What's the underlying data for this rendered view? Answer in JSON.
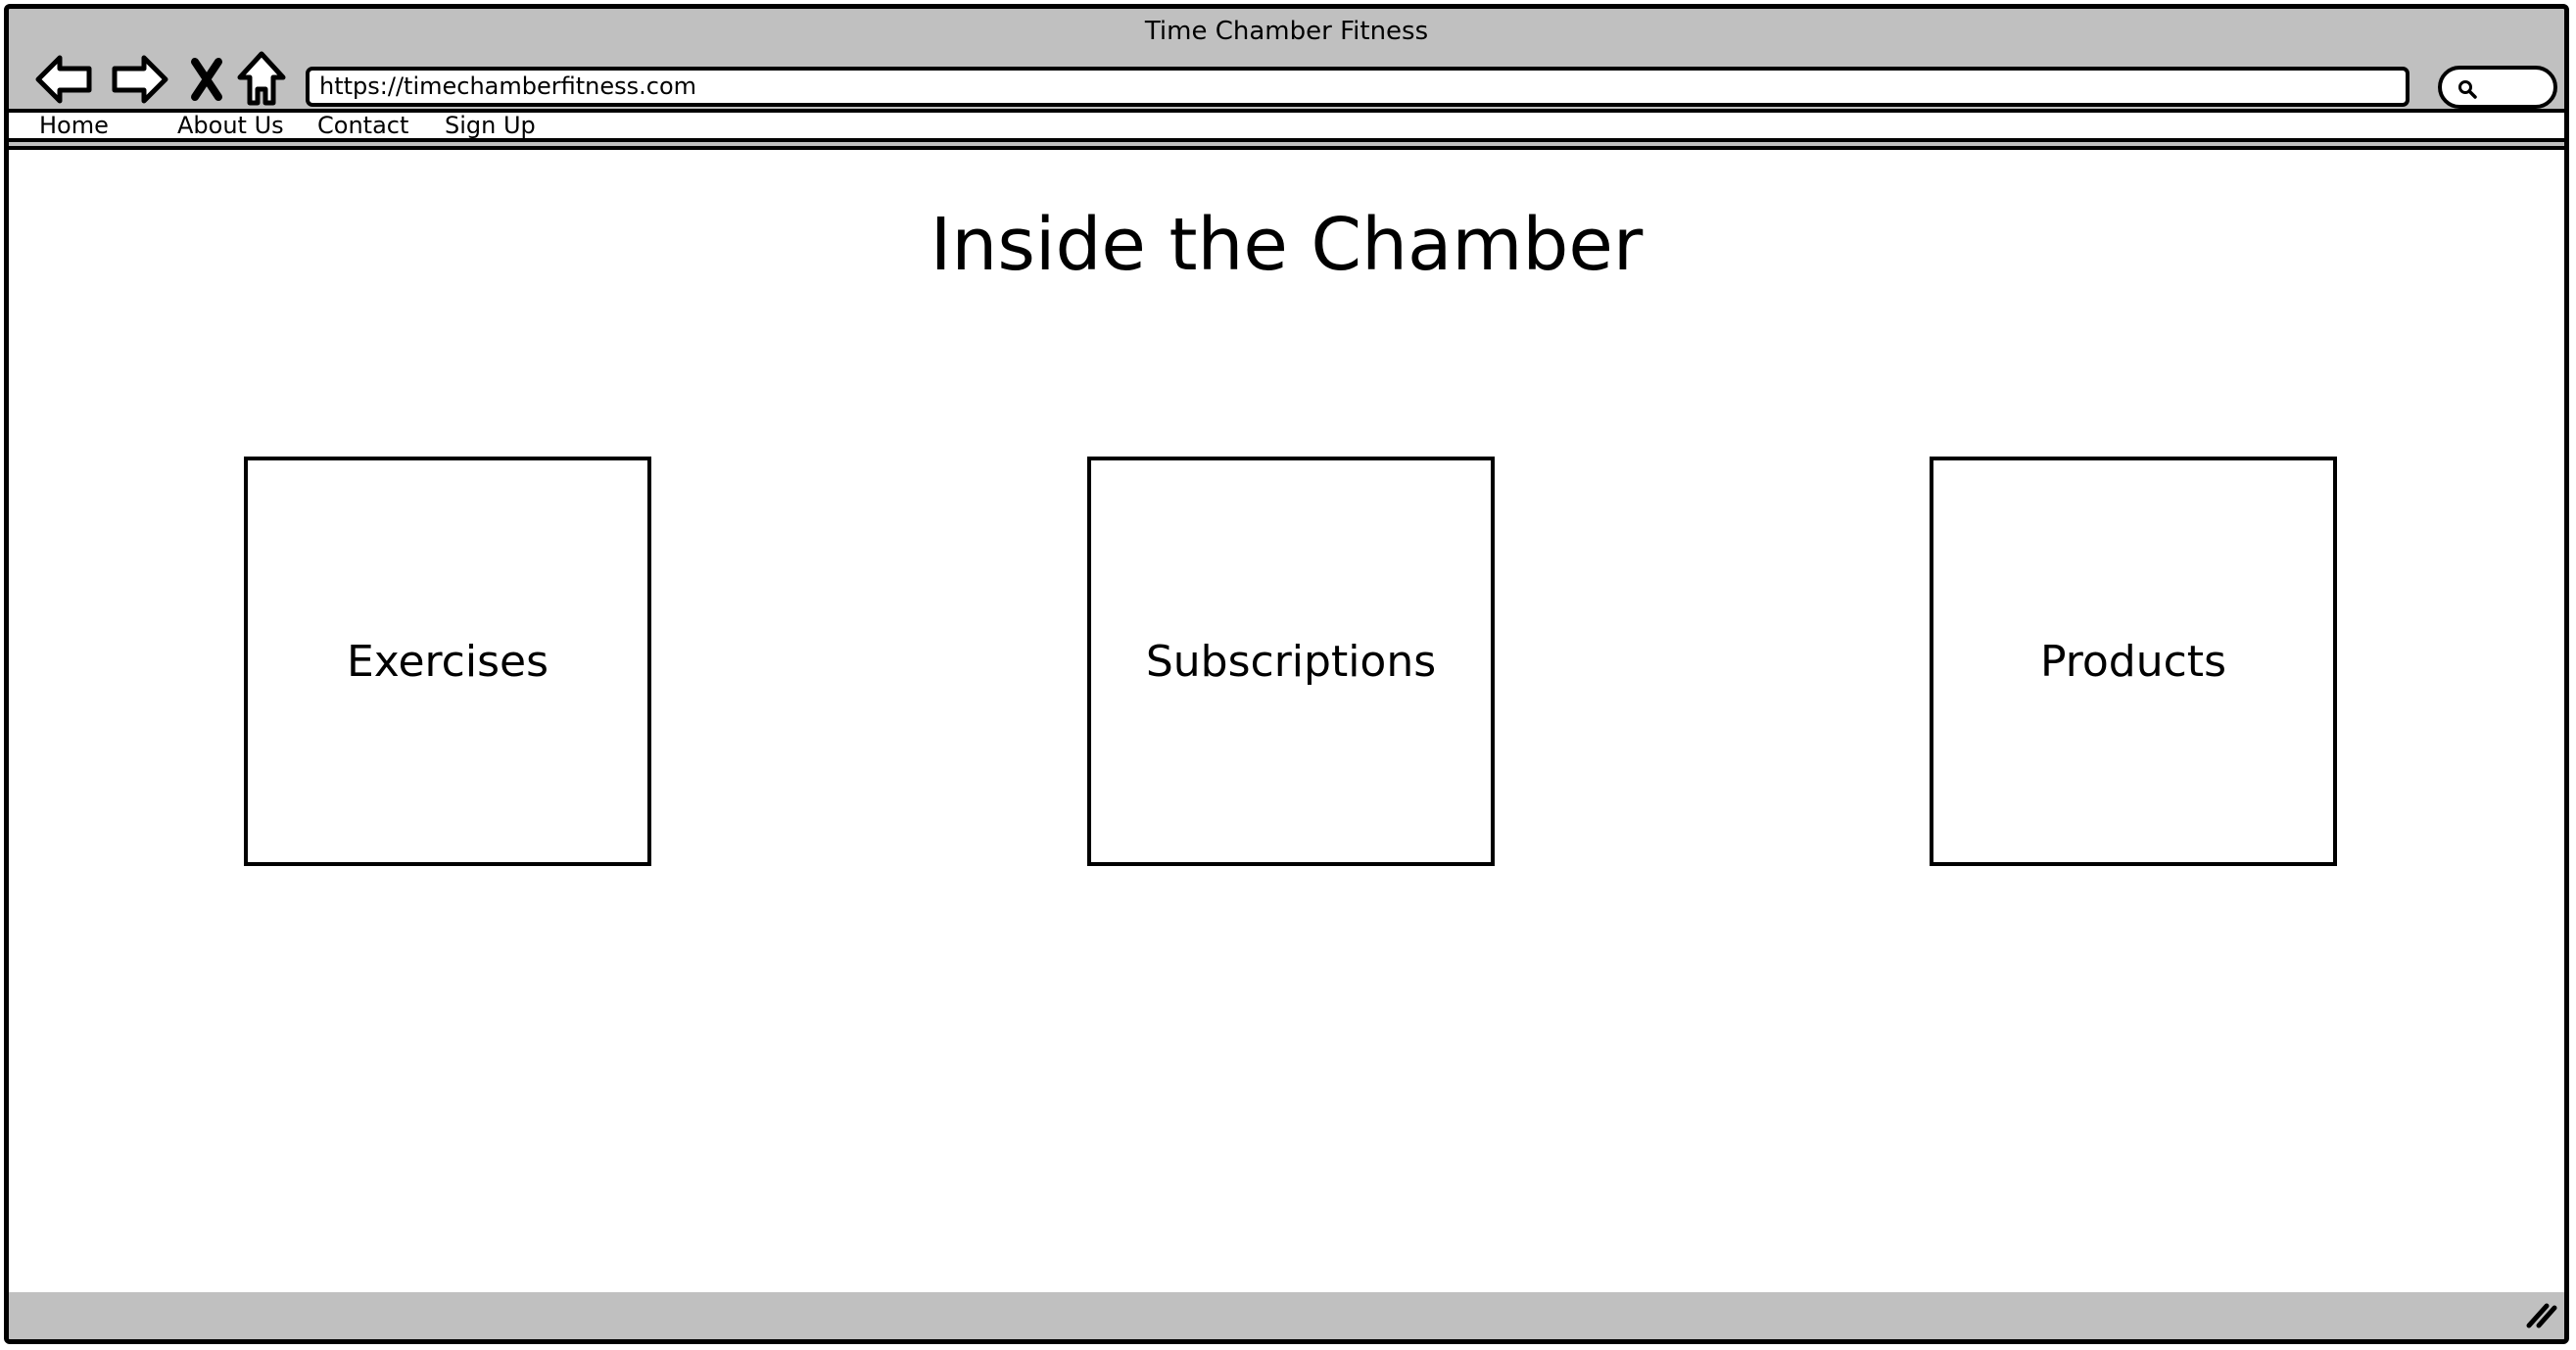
{
  "window": {
    "title": "Time Chamber Fitness"
  },
  "toolbar": {
    "back_icon": "back-arrow-icon",
    "forward_icon": "forward-arrow-icon",
    "stop_icon": "close-icon",
    "home_icon": "home-icon",
    "url": "https://timechamberfitness.com",
    "search_icon": "search-icon"
  },
  "menu": {
    "items": [
      {
        "label": "Home"
      },
      {
        "label": "About Us"
      },
      {
        "label": "Contact"
      },
      {
        "label": "Sign Up"
      }
    ]
  },
  "main": {
    "title": "Inside the Chamber",
    "cards": [
      {
        "label": "Exercises"
      },
      {
        "label": "Subscriptions"
      },
      {
        "label": "Products"
      }
    ]
  },
  "colors": {
    "chrome": "#c0c0c0",
    "stroke": "#000000",
    "canvas": "#ffffff"
  }
}
